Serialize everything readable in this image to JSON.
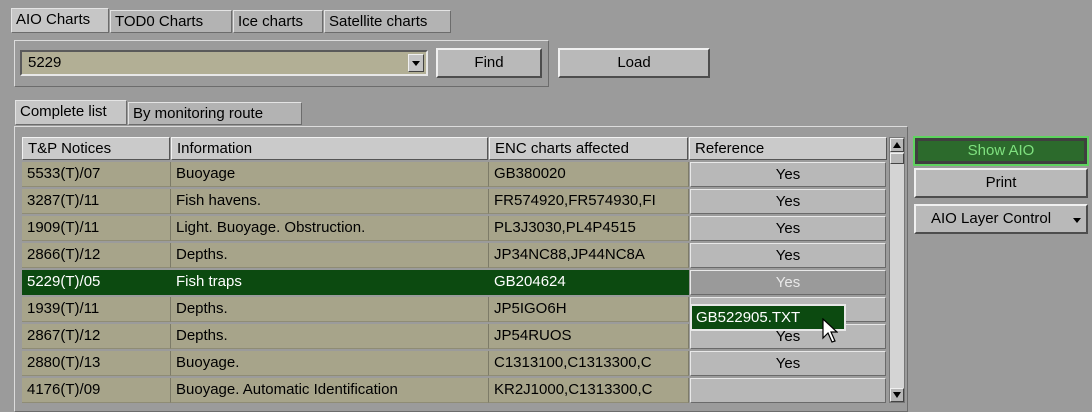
{
  "top_tabs": [
    "AIO Charts",
    "TOD0 Charts",
    "Ice charts",
    "Satellite charts"
  ],
  "search": {
    "value": "5229",
    "find_label": "Find",
    "load_label": "Load"
  },
  "sub_tabs": [
    "Complete list",
    "By monitoring route"
  ],
  "table": {
    "columns": [
      "T&P Notices",
      "Information",
      "ENC charts affected",
      "Reference"
    ],
    "rows": [
      {
        "notice": "5533(T)/07",
        "info": "Buoyage",
        "enc": "GB380020",
        "ref": "Yes"
      },
      {
        "notice": "3287(T)/11",
        "info": "Fish havens.",
        "enc": "FR574920,FR574930,FI",
        "ref": "Yes"
      },
      {
        "notice": "1909(T)/11",
        "info": "Light. Buoyage. Obstruction.",
        "enc": "PL3J3030,PL4P4515",
        "ref": "Yes"
      },
      {
        "notice": "2866(T)/12",
        "info": "Depths.",
        "enc": "JP34NC88,JP44NC8A",
        "ref": "Yes"
      },
      {
        "notice": "5229(T)/05",
        "info": "Fish traps",
        "enc": "GB204624",
        "ref": "Yes"
      },
      {
        "notice": "1939(T)/11",
        "info": "Depths.",
        "enc": "JP5IGO6H",
        "ref": ""
      },
      {
        "notice": "2867(T)/12",
        "info": "Depths.",
        "enc": "JP54RUOS",
        "ref": "Yes"
      },
      {
        "notice": "2880(T)/13",
        "info": "Buoyage.",
        "enc": "C1313100,C1313300,C",
        "ref": "Yes"
      },
      {
        "notice": "4176(T)/09",
        "info": "Buoyage. Automatic Identification",
        "enc": "KR2J1000,C1313300,C",
        "ref": ""
      }
    ],
    "selected_index": 4
  },
  "popup": {
    "label": "GB522905.TXT"
  },
  "side": {
    "show_aio": "Show AIO",
    "print": "Print",
    "layer_control": "AIO Layer Control"
  },
  "colors": {
    "selected_row": "#0c4a10",
    "row_bg": "#a7a48a",
    "show_aio_text": "#5fd35f"
  }
}
